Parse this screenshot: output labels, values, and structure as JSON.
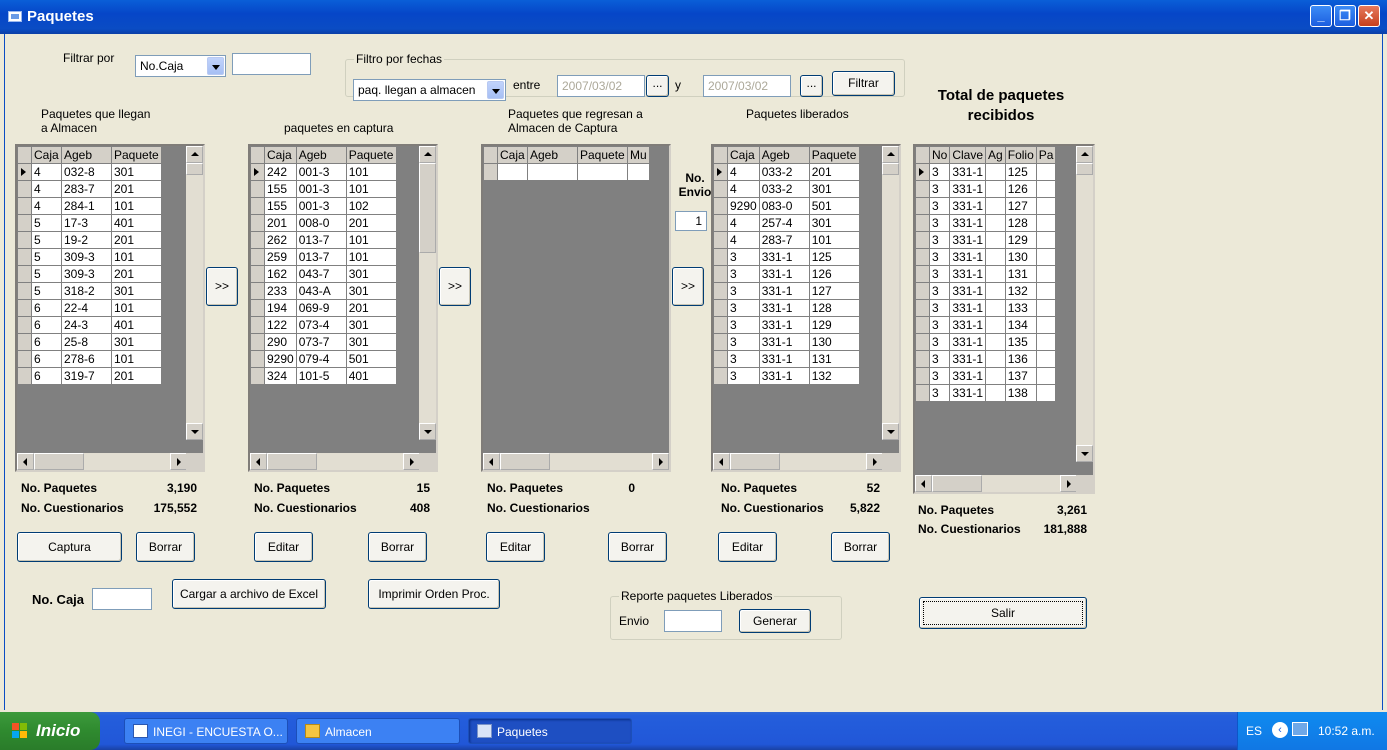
{
  "window": {
    "title": "Paquetes"
  },
  "filters": {
    "filtrar_por_label": "Filtrar por",
    "filtrar_por_value": "No.Caja",
    "filtrar_text_value": "",
    "fecha_group_title": "Filtro por fechas",
    "fecha_tipo_value": "paq. llegan a almacen",
    "entre_label": "entre",
    "fecha_desde": "2007/03/02",
    "y_label": "y",
    "fecha_hasta": "2007/03/02",
    "ellipsis": "...",
    "filtrar_button": "Filtrar"
  },
  "total_title_line1": "Total de paquetes",
  "total_title_line2": "recibidos",
  "arrow_label": ">>",
  "envio": {
    "label_line1": "No.",
    "label_line2": "Envio",
    "value": "1"
  },
  "grids": {
    "almacen": {
      "title_line1": "Paquetes que llegan",
      "title_line2": "a Almacen",
      "columns": [
        "Caja",
        "Ageb",
        "Paquete"
      ],
      "rows": [
        [
          "4",
          "032-8",
          "301"
        ],
        [
          "4",
          "283-7",
          "201"
        ],
        [
          "4",
          "284-1",
          "101"
        ],
        [
          "5",
          "17-3",
          "401"
        ],
        [
          "5",
          "19-2",
          "201"
        ],
        [
          "5",
          "309-3",
          "101"
        ],
        [
          "5",
          "309-3",
          "201"
        ],
        [
          "5",
          "318-2",
          "301"
        ],
        [
          "6",
          "22-4",
          "101"
        ],
        [
          "6",
          "24-3",
          "401"
        ],
        [
          "6",
          "25-8",
          "301"
        ],
        [
          "6",
          "278-6",
          "101"
        ],
        [
          "6",
          "319-7",
          "201"
        ]
      ],
      "no_paquetes_label": "No. Paquetes",
      "no_paquetes": "3,190",
      "no_cuest_label": "No. Cuestionarios",
      "no_cuest": "175,552",
      "btn1": "Captura",
      "btn2": "Borrar"
    },
    "captura": {
      "title_line1": "paquetes en captura",
      "columns": [
        "Caja",
        "Ageb",
        "Paquete"
      ],
      "rows": [
        [
          "242",
          "001-3",
          "101"
        ],
        [
          "155",
          "001-3",
          "101"
        ],
        [
          "155",
          "001-3",
          "102"
        ],
        [
          "201",
          "008-0",
          "201"
        ],
        [
          "262",
          "013-7",
          "101"
        ],
        [
          "259",
          "013-7",
          "101"
        ],
        [
          "162",
          "043-7",
          "301"
        ],
        [
          "233",
          "043-A",
          "301"
        ],
        [
          "194",
          "069-9",
          "201"
        ],
        [
          "122",
          "073-4",
          "301"
        ],
        [
          "290",
          "073-7",
          "301"
        ],
        [
          "9290",
          "079-4",
          "501"
        ],
        [
          "324",
          "101-5",
          "401"
        ]
      ],
      "no_paquetes_label": "No. Paquetes",
      "no_paquetes": "15",
      "no_cuest_label": "No. Cuestionarios",
      "no_cuest": "408",
      "btn1": "Editar",
      "btn2": "Borrar"
    },
    "regresan": {
      "title_line1": "Paquetes que regresan a",
      "title_line2": "Almacen de Captura",
      "columns": [
        "Caja",
        "Ageb",
        "Paquete",
        "Mu"
      ],
      "rows": [],
      "no_paquetes_label": "No. Paquetes",
      "no_paquetes": "0",
      "no_cuest_label": "No. Cuestionarios",
      "no_cuest": "",
      "btn1": "Editar",
      "btn2": "Borrar"
    },
    "liberados": {
      "title_line1": "Paquetes liberados",
      "columns": [
        "Caja",
        "Ageb",
        "Paquete"
      ],
      "rows": [
        [
          "4",
          "033-2",
          "201"
        ],
        [
          "4",
          "033-2",
          "301"
        ],
        [
          "9290",
          "083-0",
          "501"
        ],
        [
          "4",
          "257-4",
          "301"
        ],
        [
          "4",
          "283-7",
          "101"
        ],
        [
          "3",
          "331-1",
          "125"
        ],
        [
          "3",
          "331-1",
          "126"
        ],
        [
          "3",
          "331-1",
          "127"
        ],
        [
          "3",
          "331-1",
          "128"
        ],
        [
          "3",
          "331-1",
          "129"
        ],
        [
          "3",
          "331-1",
          "130"
        ],
        [
          "3",
          "331-1",
          "131"
        ],
        [
          "3",
          "331-1",
          "132"
        ]
      ],
      "no_paquetes_label": "No. Paquetes",
      "no_paquetes": "52",
      "no_cuest_label": "No. Cuestionarios",
      "no_cuest": "5,822",
      "btn1": "Editar",
      "btn2": "Borrar"
    },
    "total": {
      "columns": [
        "No",
        "Clave",
        "Ag",
        "Folio",
        "Pa"
      ],
      "rows": [
        [
          "3",
          "331-1",
          "125"
        ],
        [
          "3",
          "331-1",
          "126"
        ],
        [
          "3",
          "331-1",
          "127"
        ],
        [
          "3",
          "331-1",
          "128"
        ],
        [
          "3",
          "331-1",
          "129"
        ],
        [
          "3",
          "331-1",
          "130"
        ],
        [
          "3",
          "331-1",
          "131"
        ],
        [
          "3",
          "331-1",
          "132"
        ],
        [
          "3",
          "331-1",
          "133"
        ],
        [
          "3",
          "331-1",
          "134"
        ],
        [
          "3",
          "331-1",
          "135"
        ],
        [
          "3",
          "331-1",
          "136"
        ],
        [
          "3",
          "331-1",
          "137"
        ],
        [
          "3",
          "331-1",
          "138"
        ]
      ],
      "no_paquetes_label": "No. Paquetes",
      "no_paquetes": "3,261",
      "no_cuest_label": "No. Cuestionarios",
      "no_cuest": "181,888"
    }
  },
  "bottom": {
    "no_caja_label": "No. Caja",
    "no_caja_value": "",
    "excel_button": "Cargar a archivo de Excel",
    "imprimir_button": "Imprimir Orden Proc.",
    "reporte_group_title": "Reporte paquetes Liberados",
    "envio_label": "Envio",
    "envio_value": "",
    "generar_button": "Generar",
    "salir_button": "Salir"
  },
  "taskbar": {
    "start_label": "Inicio",
    "items": [
      "INEGI - ENCUESTA O...",
      "Almacen",
      "Paquetes"
    ],
    "lang": "ES",
    "clock": "10:52 a.m."
  }
}
